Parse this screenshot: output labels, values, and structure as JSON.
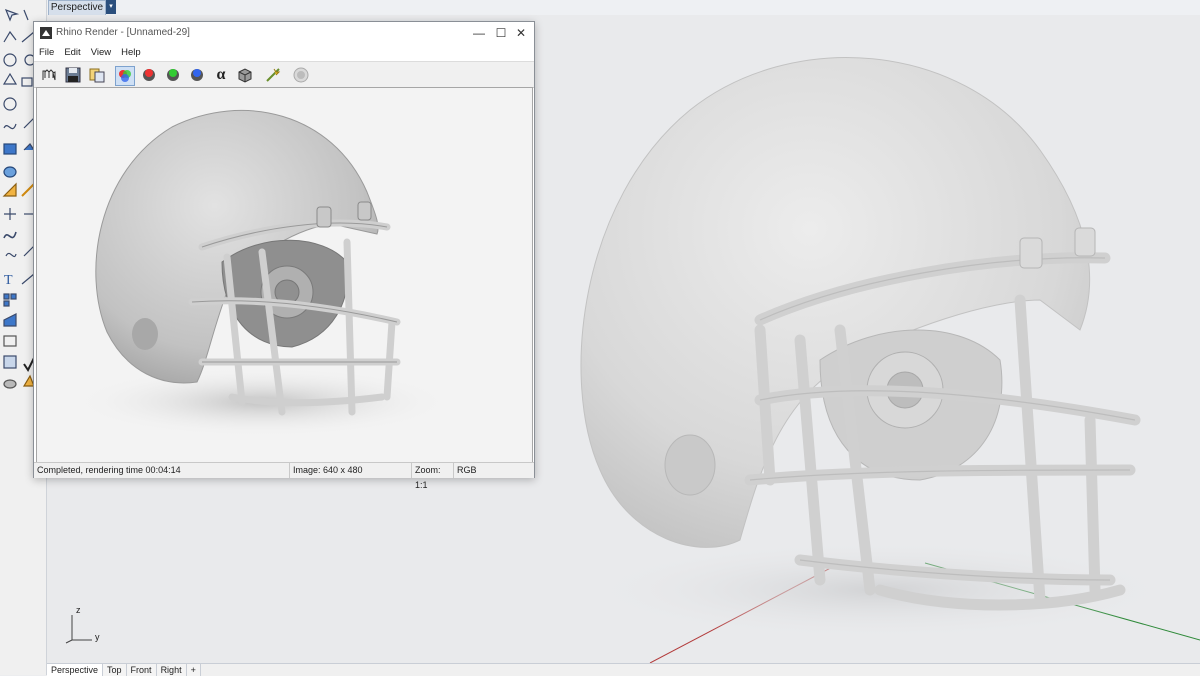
{
  "viewport": {
    "title": "Perspective",
    "menu_arrow": "▾",
    "tabs": [
      {
        "label": "Perspective",
        "active": true
      },
      {
        "label": "Top",
        "active": false
      },
      {
        "label": "Front",
        "active": false
      },
      {
        "label": "Right",
        "active": false
      },
      {
        "label": "+",
        "active": false
      }
    ],
    "axes": {
      "z": "z",
      "y": "y"
    }
  },
  "render_window": {
    "title": "Rhino Render - [Unnamed-29]",
    "window_buttons": {
      "minimize": "—",
      "maximize": "☐",
      "close": "✕"
    },
    "menu": [
      "File",
      "Edit",
      "View",
      "Help"
    ],
    "toolbar_icons": [
      "pan-icon",
      "save-icon",
      "copy-icon",
      "rgb-channels-icon",
      "red-channel-icon",
      "green-channel-icon",
      "blue-channel-icon",
      "alpha-icon",
      "material-icon",
      "post-effects-icon",
      "stop-icon"
    ],
    "alpha_symbol": "α",
    "status": {
      "message": "Completed, rendering time 00:04:14",
      "image_size": "Image: 640 x 480",
      "zoom": "Zoom: 1:1",
      "channel": "RGB"
    }
  },
  "colors": {
    "viewport_bg": "#e9eaec",
    "helmet_shell": "#dcdcdc",
    "axis_red": "#b23a3a",
    "axis_green": "#2f8a3a",
    "active_tab": "#d6dfeb"
  }
}
